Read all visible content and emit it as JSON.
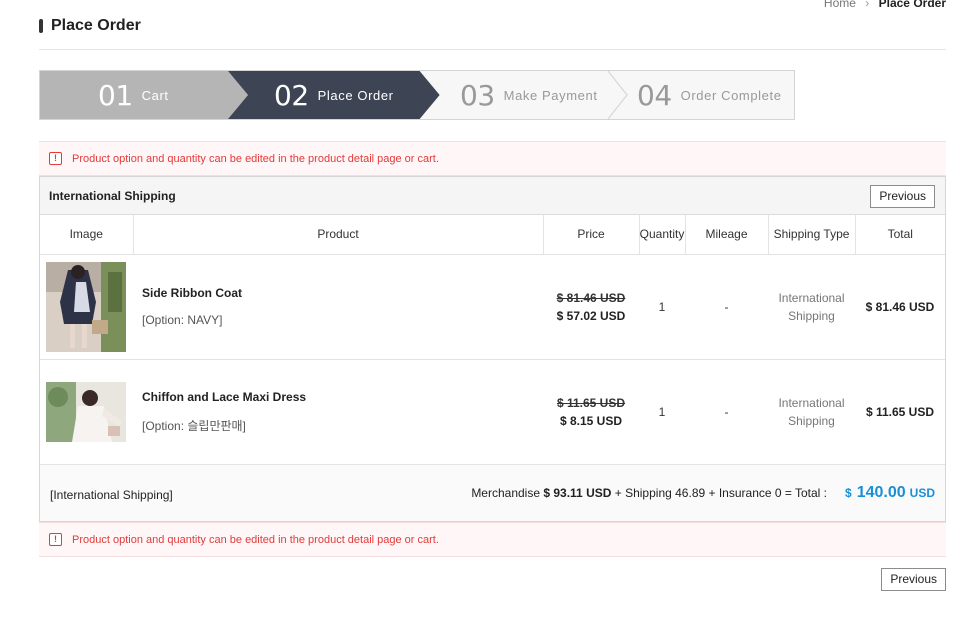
{
  "breadcrumb": {
    "home": "Home",
    "separator": ">",
    "current": "Place Order"
  },
  "page": {
    "title": "Place Order"
  },
  "steps": [
    {
      "num": "01",
      "label": "Cart",
      "state": "done"
    },
    {
      "num": "02",
      "label": "Place Order",
      "state": "active"
    },
    {
      "num": "03",
      "label": "Make Payment",
      "state": "todo"
    },
    {
      "num": "04",
      "label": "Order Complete",
      "state": "todo"
    }
  ],
  "notice": {
    "icon": "!",
    "text": "Product option and quantity can be edited in the product detail page or cart."
  },
  "order": {
    "heading": "International Shipping",
    "previous_label": "Previous",
    "columns": [
      "Image",
      "Product",
      "Price",
      "Quantity",
      "Mileage",
      "Shipping Type",
      "Total"
    ],
    "items": [
      {
        "name": "Side Ribbon Coat",
        "option": "[Option: NAVY]",
        "price_old": "$ 81.46 USD",
        "price_new": "$ 57.02 USD",
        "quantity": "1",
        "mileage": "-",
        "shipping_line1": "International",
        "shipping_line2": "Shipping",
        "total": "$ 81.46 USD"
      },
      {
        "name": "Chiffon and Lace Maxi Dress",
        "option": "[Option: 슬립만판매]",
        "price_old": "$ 11.65 USD",
        "price_new": "$ 8.15 USD",
        "quantity": "1",
        "mileage": "-",
        "shipping_line1": "International",
        "shipping_line2": "Shipping",
        "total": "$ 11.65 USD"
      }
    ],
    "summary": {
      "label": "[International Shipping]",
      "merch_label": "Merchandise",
      "merch_value": "$ 93.11 USD",
      "rest": "+ Shipping 46.89 + Insurance 0 = Total :",
      "grand_currency": "$",
      "grand_amount": "140.00",
      "grand_unit": "USD"
    }
  },
  "footer": {
    "previous_label": "Previous"
  },
  "colors": {
    "step_done": "#b5b5b5",
    "step_active": "#3d4555",
    "notice_red": "#e13b3b",
    "total_blue": "#1a8fd6"
  }
}
